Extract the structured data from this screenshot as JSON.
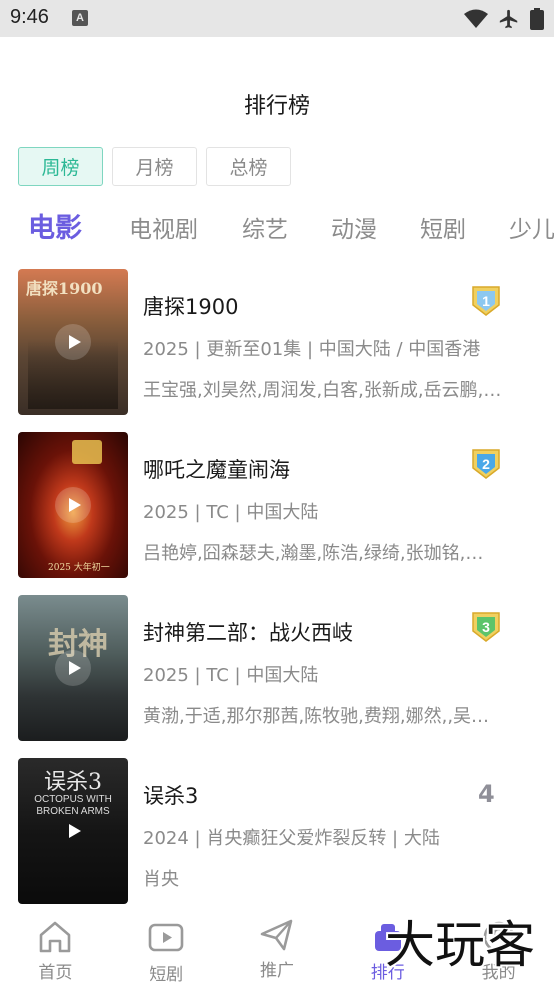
{
  "status_bar": {
    "time": "9:46",
    "notification_letter": "A"
  },
  "page": {
    "title": "排行榜"
  },
  "period_tabs": [
    {
      "label": "周榜",
      "active": true
    },
    {
      "label": "月榜",
      "active": false
    },
    {
      "label": "总榜",
      "active": false
    }
  ],
  "category_tabs": [
    {
      "label": "电影",
      "active": true
    },
    {
      "label": "电视剧",
      "active": false
    },
    {
      "label": "综艺",
      "active": false
    },
    {
      "label": "动漫",
      "active": false
    },
    {
      "label": "短剧",
      "active": false
    },
    {
      "label": "少儿",
      "active": false
    }
  ],
  "ranking": [
    {
      "rank": "1",
      "title": "唐探1900",
      "meta": "2025 | 更新至01集 | 中国大陆 / 中国香港",
      "cast": "王宝强,刘昊然,周润发,白客,张新成,岳云鹏,…",
      "poster_text": "唐探1900",
      "badge": "gold"
    },
    {
      "rank": "2",
      "title": "哪吒之魔童闹海",
      "meta": "2025 | TC | 中国大陆",
      "cast": "吕艳婷,囧森瑟夫,瀚墨,陈浩,绿绮,张珈铭,…",
      "poster_text": "2025 大年初一",
      "badge": "blue"
    },
    {
      "rank": "3",
      "title": "封神第二部：战火西岐",
      "meta": "2025 | TC | 中国大陆",
      "cast": "黄渤,于适,那尔那茜,陈牧驰,费翔,娜然,,吴…",
      "poster_text": "封神",
      "badge": "green"
    },
    {
      "rank": "4",
      "title": "误杀3",
      "meta": "2024 | 肖央癫狂父爱炸裂反转 | 大陆",
      "cast": "肖央",
      "poster_text": "误杀3",
      "poster_sub": "OCTOPUS WITH BROKEN ARMS",
      "badge": "none"
    }
  ],
  "bottom_nav": [
    {
      "label": "首页",
      "icon": "home-icon",
      "active": false
    },
    {
      "label": "短剧",
      "icon": "video-play-icon",
      "active": false
    },
    {
      "label": "推广",
      "icon": "paper-plane-icon",
      "active": false
    },
    {
      "label": "排行",
      "icon": "ranking-icon",
      "active": true
    },
    {
      "label": "我的",
      "icon": "profile-icon",
      "active": false
    }
  ],
  "watermark": {
    "text": "大玩客"
  },
  "colors": {
    "accent": "#6b5de0",
    "period_active_text": "#2cb895",
    "period_active_bg": "#e6f8f3",
    "badge_gold": "#e8c44a",
    "badge_blue": "#4aa8e8",
    "badge_green": "#5cc46a"
  }
}
